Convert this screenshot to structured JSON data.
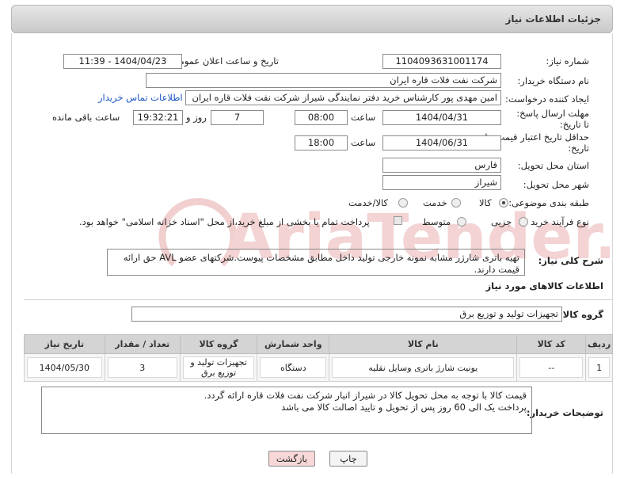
{
  "header": {
    "title": "جزئیات اطلاعات نیاز"
  },
  "fields": {
    "need_number": {
      "label": "شماره نیاز:",
      "value": "1104093631001174"
    },
    "announce_datetime": {
      "label": "تاریخ و ساعت اعلان عمومی:",
      "value": "1404/04/23 - 11:39"
    },
    "buyer_org": {
      "label": "نام دستگاه خریدار:",
      "value": "شرکت نفت فلات قاره ایران"
    },
    "requester": {
      "label": "ایجاد کننده درخواست:",
      "value": "امین مهدی پور کارشناس خرید دفتر نمایندگی شیراز شرکت نفت فلات قاره ایران",
      "contact_link": "اطلاعات تماس خریدار"
    },
    "reply_deadline": {
      "label": "مهلت ارسال پاسخ: تا تاریخ:",
      "date": "1404/04/31",
      "time_label": "ساعت",
      "time": "08:00",
      "days": "7",
      "days_label": "روز و",
      "remaining": "19:32:21",
      "remaining_label": "ساعت باقی مانده"
    },
    "price_validity": {
      "label": "حداقل تاریخ اعتبار قیمت: تا تاریخ:",
      "date": "1404/06/31",
      "time_label": "ساعت",
      "time": "18:00"
    },
    "delivery_province": {
      "label": "استان محل تحویل:",
      "value": "فارس"
    },
    "delivery_city": {
      "label": "شهر محل تحویل:",
      "value": "شیراز"
    },
    "category": {
      "label": "طبقه بندی موضوعی:",
      "options": [
        "کالا",
        "خدمت",
        "کالا/خدمت"
      ],
      "selected": "کالا"
    },
    "process_type": {
      "label": "نوع فرآیند خرید :",
      "options": [
        "جزیی",
        "متوسط"
      ],
      "selected": "",
      "payment_note": "پرداخت تمام یا بخشی از مبلغ خرید،از محل \"اسناد خزانه اسلامی\" خواهد بود."
    }
  },
  "description": {
    "label": "شرح کلی نیاز:",
    "value": "تهیه باتری شارژر مشابه نمونه خارجی تولید داخل مطابق مشخصات پیوست.شرکتهای عضو AVL حق ارائه قیمت دارند."
  },
  "goods_section": {
    "title": "اطلاعات کالاهای مورد نیاز",
    "group_label": "گروه کالا:",
    "group_value": "تجهیزات تولید و توزیع برق"
  },
  "goods_table": {
    "headers": [
      "ردیف",
      "کد کالا",
      "نام کالا",
      "واحد شمارش",
      "گروه کالا",
      "تعداد / مقدار",
      "تاریخ نیاز"
    ],
    "rows": [
      [
        "1",
        "--",
        "یونیت شارژ باتری وسایل نقلیه",
        "دستگاه",
        "تجهیزات تولید و توزیع برق",
        "3",
        "1404/05/30"
      ]
    ]
  },
  "buyer_notes": {
    "label": "توضیحات خریدار:",
    "lines": [
      "قیمت کالا با توجه به محل تحویل کالا در شیراز انبار شرکت نفت فلات قاره ارائه گردد.",
      "پرداخت  یک الی 60 روز پس از تحویل و تایید اصالت کالا می باشد"
    ]
  },
  "buttons": {
    "print": "چاپ",
    "back": "بازگشت"
  },
  "watermark": {
    "text": "AriaTender.neT"
  },
  "colors": {
    "link": "#1a55c4",
    "back_button": "#f7d7d7",
    "print_button": "#f4f4f4",
    "watermark": "#f3d3d3"
  }
}
